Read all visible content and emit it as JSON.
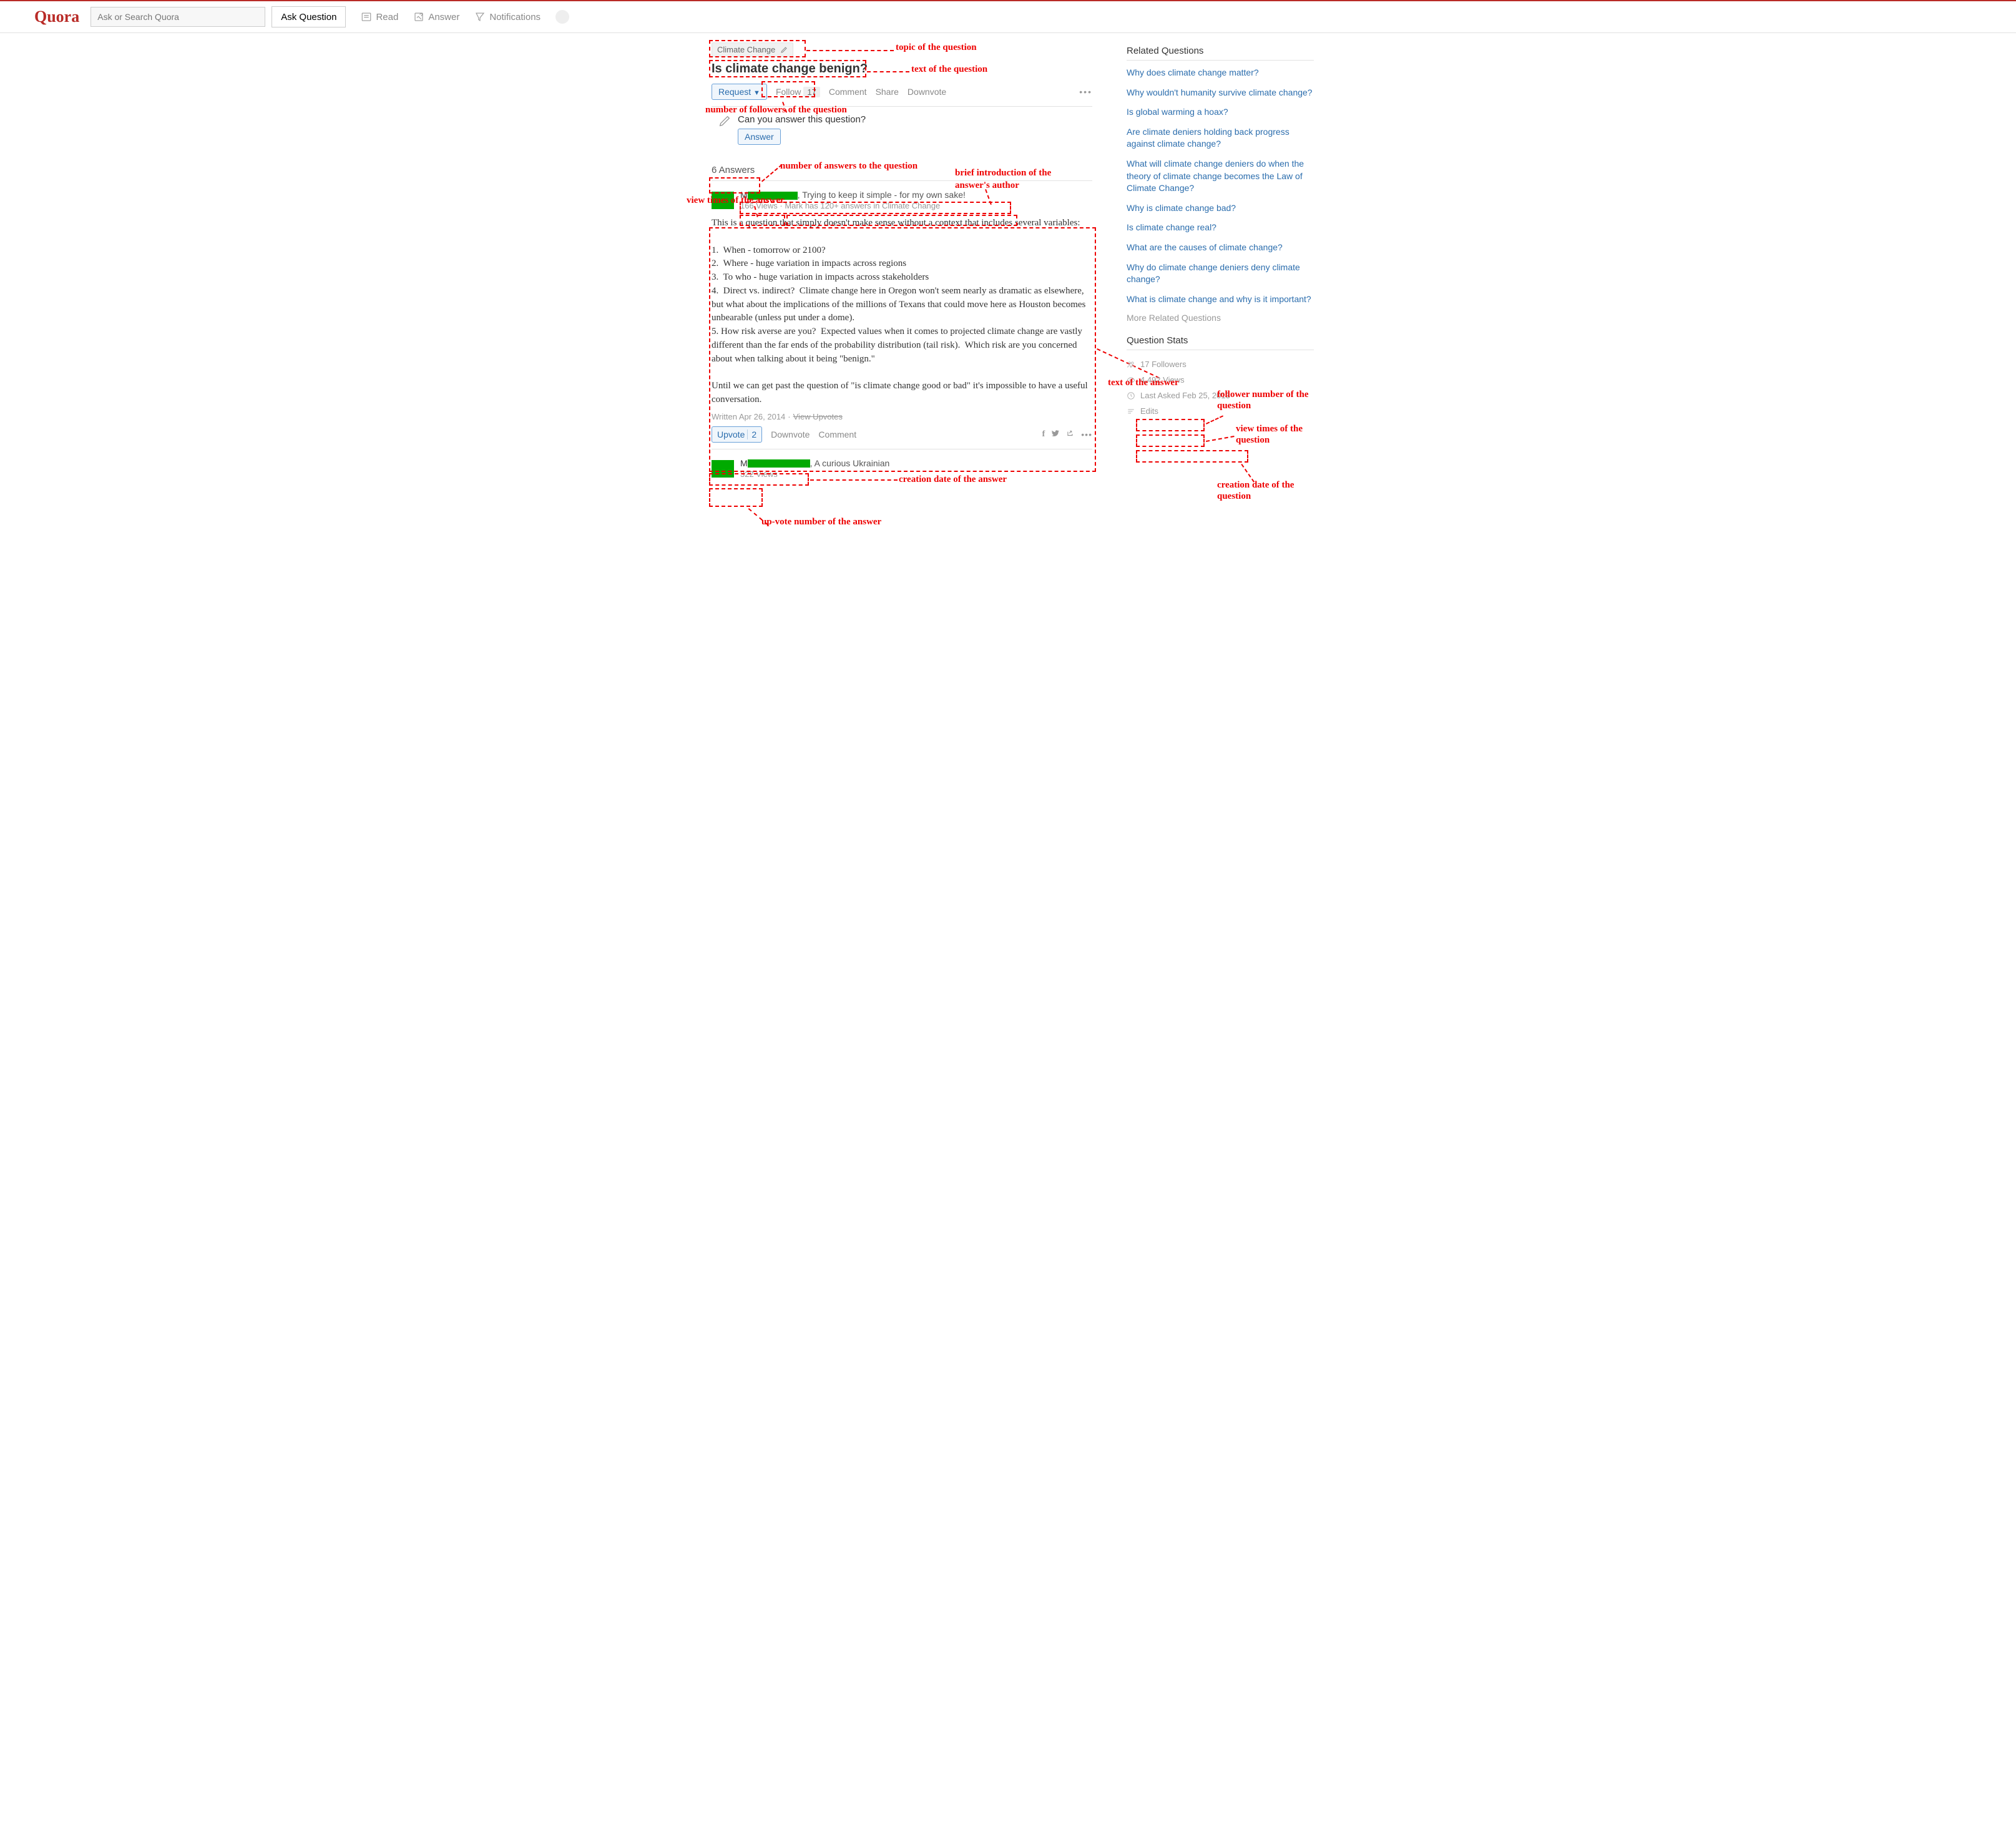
{
  "header": {
    "logo": "Quora",
    "search_placeholder": "Ask or Search Quora",
    "ask_button": "Ask Question",
    "nav": {
      "read": "Read",
      "answer": "Answer",
      "notifications": "Notifications"
    }
  },
  "question": {
    "topic": "Climate Change",
    "title": "Is climate change benign?",
    "actions": {
      "request": "Request",
      "follow": "Follow",
      "follow_count": "17",
      "comment": "Comment",
      "share": "Share",
      "downvote": "Downvote"
    },
    "prompt": {
      "text": "Can you answer this question?",
      "button": "Answer"
    },
    "answers_count_label": "6 Answers"
  },
  "answer1": {
    "author_initial": "M",
    "bio": ", Trying to keep it simple - for my own sake!",
    "views": "166 Views",
    "credential": "Mark has 120+ answers in Climate Change",
    "body": "This is a question that simply doesn't make sense without a context that includes several variables:\n\n1.  When - tomorrow or 2100?\n2.  Where - huge variation in impacts across regions\n3.  To who - huge variation in impacts across stakeholders\n4.  Direct vs. indirect?  Climate change here in Oregon won't seem nearly as dramatic as elsewhere, but what about the implications of the millions of Texans that could move here as Houston becomes unbearable (unless put under a dome).\n5. How risk averse are you?  Expected values when it comes to projected climate change are vastly different than the far ends of the probability distribution (tail risk).  Which risk are you concerned about when talking about it being \"benign.\"\n\nUntil we can get past the question of \"is climate change good or bad\" it's impossible to have a useful conversation.",
    "written": "Written Apr 26, 2014",
    "view_upvotes": "View Upvotes",
    "actions": {
      "upvote": "Upvote",
      "upvote_count": "2",
      "downvote": "Downvote",
      "comment": "Comment"
    }
  },
  "answer2": {
    "author_initial": "M",
    "bio": ", A curious Ukrainian",
    "views": "322 Views"
  },
  "sidebar": {
    "related_title": "Related Questions",
    "related": [
      "Why does climate change matter?",
      "Why wouldn't humanity survive climate change?",
      "Is global warming a hoax?",
      "Are climate deniers holding back progress against climate change?",
      "What will climate change deniers do when the theory of climate change becomes the Law of Climate Change?",
      "Why is climate change bad?",
      "Is climate change real?",
      "What are the causes of climate change?",
      "Why do climate change deniers deny climate change?",
      "What is climate change and why is it important?"
    ],
    "more": "More Related Questions",
    "stats_title": "Question Stats",
    "stats": {
      "followers": "17 Followers",
      "views": "4,492 Views",
      "last_asked": "Last Asked Feb 25, 2013",
      "edits": "Edits"
    }
  },
  "annotations": {
    "topic": "topic of the question",
    "qtext": "text of the question",
    "followers": "number  of followers  of the question",
    "nanswers": "number of answers to the question",
    "authorbio": "brief introduction of the answer's author",
    "viewtimes": "view times of the answer",
    "answertext": "text of the answer",
    "creationdate": "creation date of the answer",
    "upvotes": "up-vote number of the answer",
    "qfollowers": "follower number of the question",
    "qviews": "view times of the question",
    "qcreation": "creation date of the question"
  }
}
